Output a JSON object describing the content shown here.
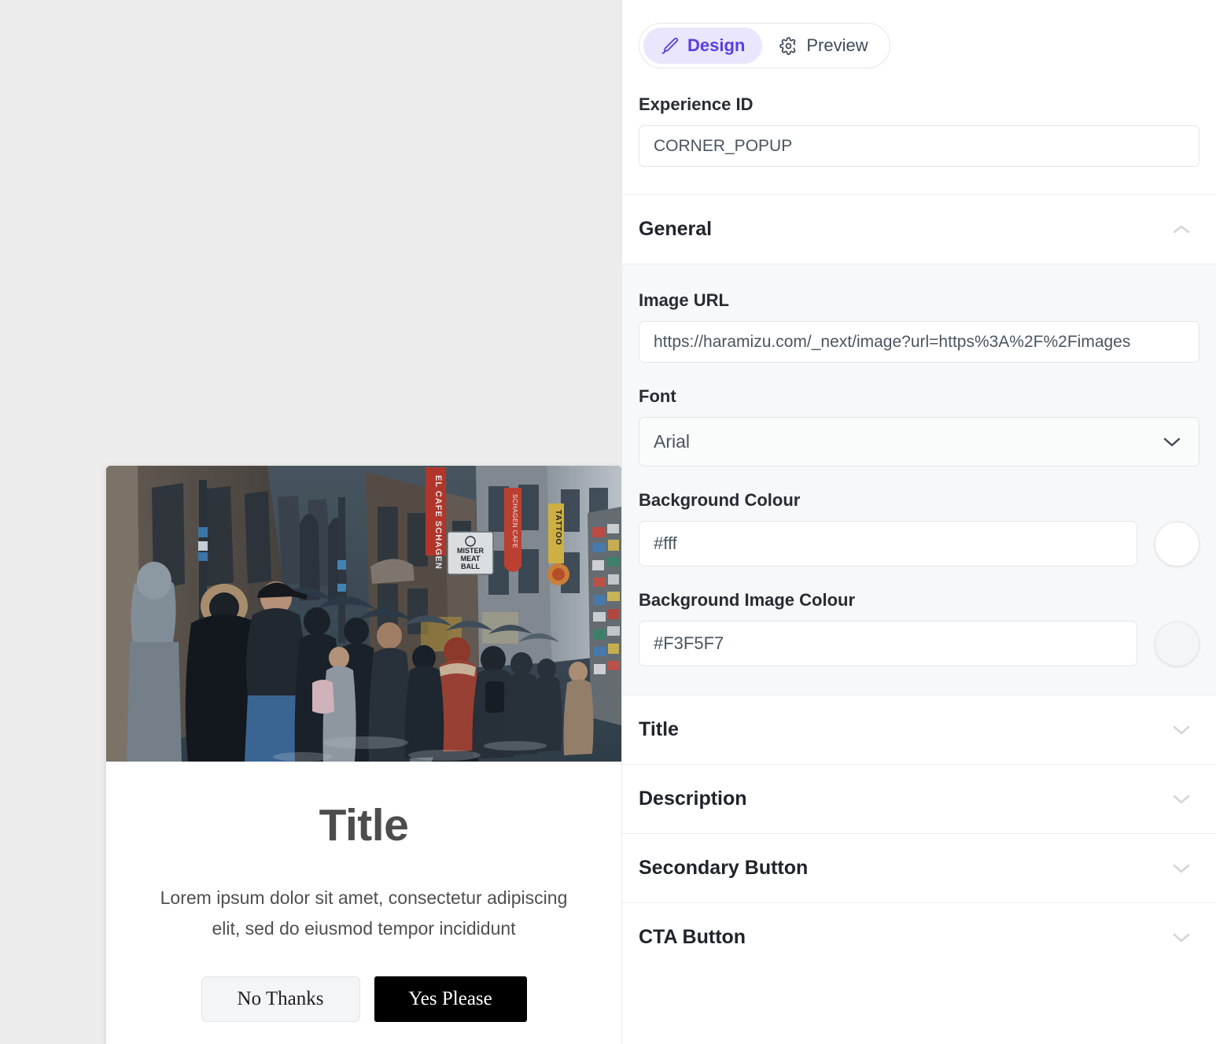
{
  "mode_tabs": [
    {
      "label": "Design",
      "icon": "brush-icon",
      "active": true
    },
    {
      "label": "Preview",
      "icon": "gear-icon",
      "active": false
    }
  ],
  "experience": {
    "label": "Experience ID",
    "value": "CORNER_POPUP",
    "placeholder": "Experience ID"
  },
  "sections": {
    "general": {
      "title": "General",
      "expanded": true,
      "chevron": "chevron-up-icon",
      "image_url": {
        "label": "Image URL",
        "value": "https://haramizu.com/_next/image?url=https%3A%2F%2Fimages",
        "placeholder": "Image URL"
      },
      "font": {
        "label": "Font",
        "value": "Arial",
        "chevron": "chevron-down-icon"
      },
      "background_colour": {
        "label": "Background Colour",
        "value": "#fff",
        "swatch": "#ffffff",
        "placeholder": "#ffffff"
      },
      "background_image_colour": {
        "label": "Background Image Colour",
        "value": "#F3F5F7",
        "swatch": "#F3F5F7",
        "placeholder": "#F3F5F7"
      }
    },
    "collapsed": [
      {
        "title": "Title",
        "chevron": "chevron-down-icon"
      },
      {
        "title": "Description",
        "chevron": "chevron-down-icon"
      },
      {
        "title": "Secondary Button",
        "chevron": "chevron-down-icon"
      },
      {
        "title": "CTA Button",
        "chevron": "chevron-down-icon"
      }
    ]
  },
  "preview_popup": {
    "title": "Title",
    "description": "Lorem ipsum dolor sit amet, consectetur adipiscing elit, sed do eiusmod tempor incididunt",
    "secondary_button": "No Thanks",
    "cta_button": "Yes Please",
    "image_alt": "rainy city street crowd with umbrellas",
    "image_signs": [
      "EL CAFE SCHAGEN",
      "MISTER MEAT BALL",
      "TATTOO"
    ]
  },
  "colors": {
    "accent": "#5b3fe0",
    "accent_bg": "#e9e6fd",
    "canvas_bg": "#ececec",
    "panel_bg": "#ffffff",
    "section_body_bg": "#f7f8f9",
    "cta_bg": "#000000",
    "secondary_bg": "#f4f5f6"
  }
}
